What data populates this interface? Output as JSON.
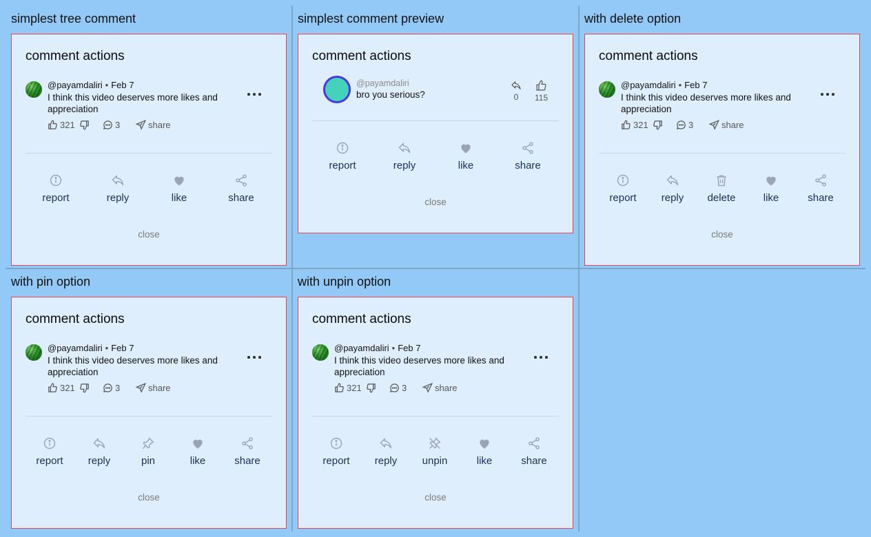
{
  "colors": {
    "background": "#93c9f6",
    "card": "#deeefc",
    "card_border": "#e5454f",
    "action_label": "#1a2e5c",
    "icon": "#9aa4b2"
  },
  "comment": {
    "username": "@payamdaliri",
    "date": "Feb 7",
    "text": "I think this video deserves more likes and appreciation",
    "likes": "321",
    "replies": "3",
    "share": "share"
  },
  "preview_comment": {
    "username": "@payamdaliri",
    "text": "bro you serious?",
    "reply_count": "0",
    "like_count": "115"
  },
  "cells": [
    {
      "title": "simplest tree comment",
      "card_title": "comment actions",
      "close": "close",
      "actions": [
        {
          "label": "report",
          "icon": "info-icon"
        },
        {
          "label": "reply",
          "icon": "reply-icon"
        },
        {
          "label": "like",
          "icon": "heart-icon"
        },
        {
          "label": "share",
          "icon": "share-icon"
        }
      ]
    },
    {
      "title": "simplest comment preview",
      "card_title": "comment actions",
      "close": "close",
      "actions": [
        {
          "label": "report",
          "icon": "info-icon"
        },
        {
          "label": "reply",
          "icon": "reply-icon"
        },
        {
          "label": "like",
          "icon": "heart-icon"
        },
        {
          "label": "share",
          "icon": "share-icon"
        }
      ]
    },
    {
      "title": "with delete option",
      "card_title": "comment actions",
      "close": "close",
      "actions": [
        {
          "label": "report",
          "icon": "info-icon"
        },
        {
          "label": "reply",
          "icon": "reply-icon"
        },
        {
          "label": "delete",
          "icon": "trash-icon"
        },
        {
          "label": "like",
          "icon": "heart-icon"
        },
        {
          "label": "share",
          "icon": "share-icon"
        }
      ]
    },
    {
      "title": "with pin option",
      "card_title": "comment actions",
      "close": "close",
      "actions": [
        {
          "label": "report",
          "icon": "info-icon"
        },
        {
          "label": "reply",
          "icon": "reply-icon"
        },
        {
          "label": "pin",
          "icon": "pin-icon"
        },
        {
          "label": "like",
          "icon": "heart-icon"
        },
        {
          "label": "share",
          "icon": "share-icon"
        }
      ]
    },
    {
      "title": "with unpin option",
      "card_title": "comment actions",
      "close": "close",
      "actions": [
        {
          "label": "report",
          "icon": "info-icon"
        },
        {
          "label": "reply",
          "icon": "reply-icon"
        },
        {
          "label": "unpin",
          "icon": "unpin-icon"
        },
        {
          "label": "like",
          "icon": "heart-icon"
        },
        {
          "label": "share",
          "icon": "share-icon"
        }
      ]
    }
  ]
}
